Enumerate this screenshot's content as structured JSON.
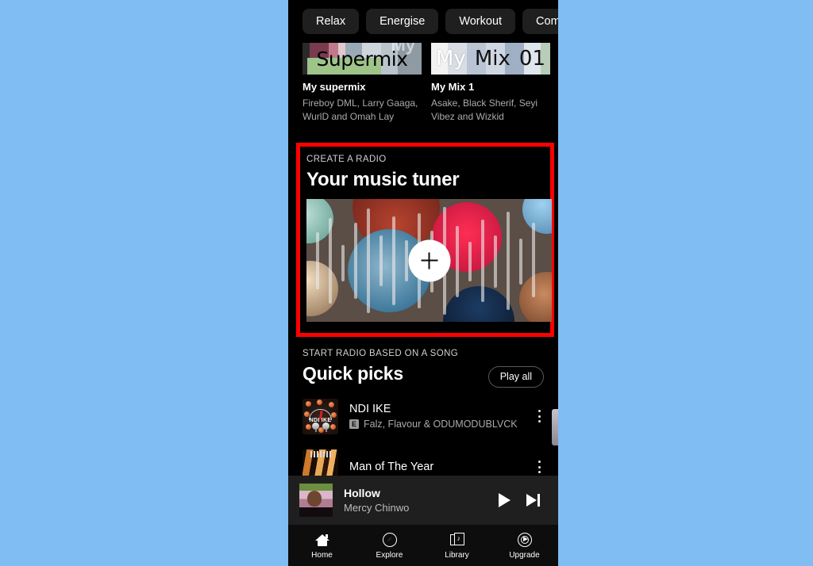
{
  "background_color": "#80bdf2",
  "highlight_color": "#ff0000",
  "chips": [
    {
      "label": "Relax"
    },
    {
      "label": "Energise"
    },
    {
      "label": "Workout"
    },
    {
      "label": "Commute"
    }
  ],
  "mixes": [
    {
      "thumb_text": "Supermix",
      "thumb_ghost": "My",
      "title": "My supermix",
      "subtitle": "Fireboy DML, Larry Gaaga, WurlD and Omah Lay"
    },
    {
      "thumb_a": "My",
      "thumb_b": "Mix",
      "thumb_c": "01",
      "title": "My Mix 1",
      "subtitle": "Asake, Black Sherif, Seyi Vibez and Wizkid"
    }
  ],
  "tuner": {
    "kicker": "CREATE A RADIO",
    "title": "Your music tuner",
    "add_label": "+"
  },
  "quick_picks": {
    "kicker": "START RADIO BASED ON A SONG",
    "title": "Quick picks",
    "play_all_label": "Play all",
    "songs": [
      {
        "title": "NDI IKE",
        "explicit": "E",
        "artists": "Falz, Flavour & ODUMODUBLVCK",
        "art_text": "NDI IKE"
      },
      {
        "title": "Man of The Year",
        "explicit": "",
        "artists": "",
        "art_text": ""
      }
    ]
  },
  "now_playing": {
    "title": "Hollow",
    "artist": "Mercy Chinwo",
    "play_icon": "play-icon",
    "next_icon": "next-track-icon"
  },
  "nav": [
    {
      "label": "Home",
      "icon": "home-icon"
    },
    {
      "label": "Explore",
      "icon": "compass-icon"
    },
    {
      "label": "Library",
      "icon": "library-icon"
    },
    {
      "label": "Upgrade",
      "icon": "upgrade-icon"
    }
  ]
}
